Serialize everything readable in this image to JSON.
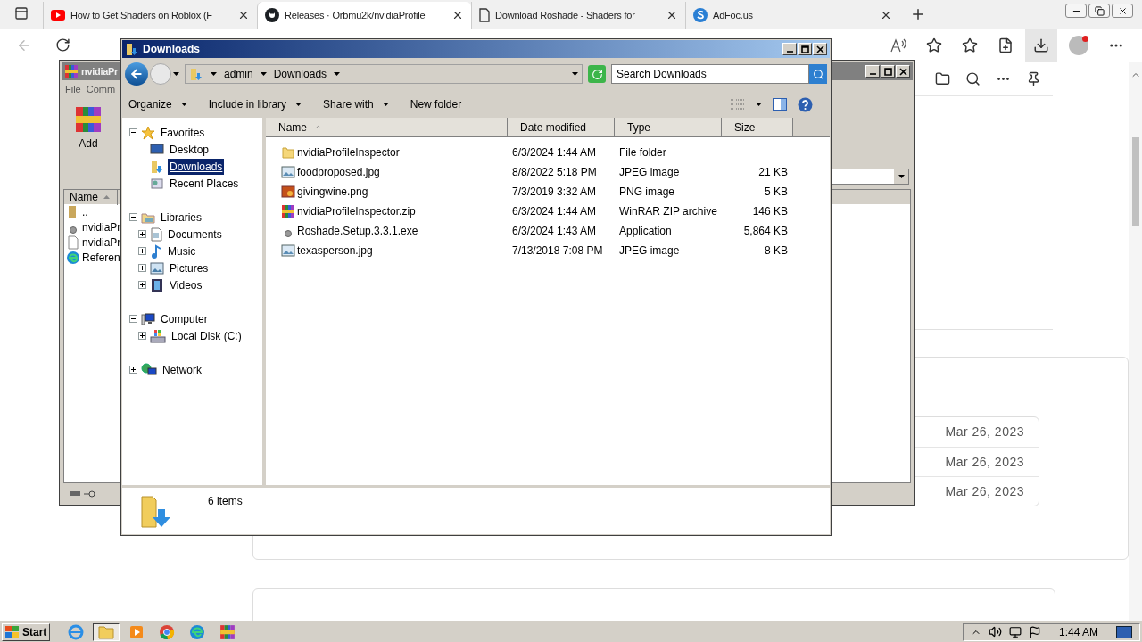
{
  "browser": {
    "tabs": [
      {
        "title": "How to Get Shaders on Roblox (F",
        "kind": "youtube",
        "selected": false
      },
      {
        "title": "Releases · Orbmu2k/nvidiaProfile",
        "kind": "github",
        "selected": true
      },
      {
        "title": "Download Roshade - Shaders for",
        "kind": "page",
        "selected": false
      },
      {
        "title": "AdFoc.us",
        "kind": "adfoc",
        "selected": false
      }
    ],
    "page_dates": [
      "Mar 26, 2023",
      "Mar 26, 2023",
      "Mar 26, 2023"
    ]
  },
  "winrar": {
    "title": "nvidiaPr",
    "menu": [
      "File",
      "Comm"
    ],
    "toolbar": [
      "Add"
    ],
    "column": "Name",
    "rows": [
      {
        "name": "..",
        "kind": "up"
      },
      {
        "name": "nvidiaPr",
        "kind": "exe"
      },
      {
        "name": "nvidiaPr",
        "kind": "file"
      },
      {
        "name": "Referen",
        "kind": "edge"
      }
    ]
  },
  "explorer": {
    "title": "Downloads",
    "breadcrumb": [
      "admin",
      "Downloads"
    ],
    "search": {
      "placeholder": "Search Downloads"
    },
    "toolbar": [
      {
        "label": "Organize",
        "dropdown": true
      },
      {
        "label": "Include in library",
        "dropdown": true
      },
      {
        "label": "Share with",
        "dropdown": true
      },
      {
        "label": "New folder",
        "dropdown": false
      }
    ],
    "nav": [
      {
        "label": "Favorites",
        "kind": "star",
        "expanded": true,
        "children": [
          {
            "label": "Desktop",
            "kind": "desktop",
            "selected": false
          },
          {
            "label": "Downloads",
            "kind": "downloads",
            "selected": true
          },
          {
            "label": "Recent Places",
            "kind": "recent",
            "selected": false
          }
        ]
      },
      {
        "label": "Libraries",
        "kind": "library",
        "expanded": true,
        "children": [
          {
            "label": "Documents",
            "kind": "documents",
            "expanded": false,
            "selected": false
          },
          {
            "label": "Music",
            "kind": "music",
            "expanded": false,
            "selected": false
          },
          {
            "label": "Pictures",
            "kind": "pictures",
            "expanded": false,
            "selected": false
          },
          {
            "label": "Videos",
            "kind": "videos",
            "expanded": false,
            "selected": false
          }
        ]
      },
      {
        "label": "Computer",
        "kind": "computer",
        "expanded": true,
        "children": [
          {
            "label": "Local Disk (C:)",
            "kind": "disk",
            "expanded": false,
            "selected": false
          }
        ]
      },
      {
        "label": "Network",
        "kind": "network",
        "expanded": false
      }
    ],
    "columns": [
      "Name",
      "Date modified",
      "Type",
      "Size"
    ],
    "files": [
      {
        "name": "nvidiaProfileInspector",
        "date": "6/3/2024 1:44 AM",
        "type": "File folder",
        "kind": "folder"
      },
      {
        "name": "foodproposed.jpg",
        "date": "8/8/2022 5:18 PM",
        "type": "JPEG image",
        "size": "21 KB",
        "kind": "image"
      },
      {
        "name": "givingwine.png",
        "date": "7/3/2019 3:32 AM",
        "type": "PNG image",
        "size": "5 KB",
        "kind": "png"
      },
      {
        "name": "nvidiaProfileInspector.zip",
        "date": "6/3/2024 1:44 AM",
        "type": "WinRAR ZIP archive",
        "size": "146 KB",
        "kind": "zip"
      },
      {
        "name": "Roshade.Setup.3.3.1.exe",
        "date": "6/3/2024 1:43 AM",
        "type": "Application",
        "size": "5,864 KB",
        "kind": "exe"
      },
      {
        "name": "texasperson.jpg",
        "date": "7/13/2018 7:08 PM",
        "type": "JPEG image",
        "size": "8 KB",
        "kind": "image"
      }
    ],
    "status": "6 items"
  },
  "taskbar": {
    "start": "Start",
    "apps": [
      {
        "kind": "ie",
        "selected": false
      },
      {
        "kind": "explorer",
        "selected": true
      },
      {
        "kind": "media",
        "selected": false
      },
      {
        "kind": "chrome",
        "selected": false
      },
      {
        "kind": "edge",
        "selected": false
      },
      {
        "kind": "winrar",
        "selected": false
      }
    ],
    "time": "1:44 AM"
  }
}
